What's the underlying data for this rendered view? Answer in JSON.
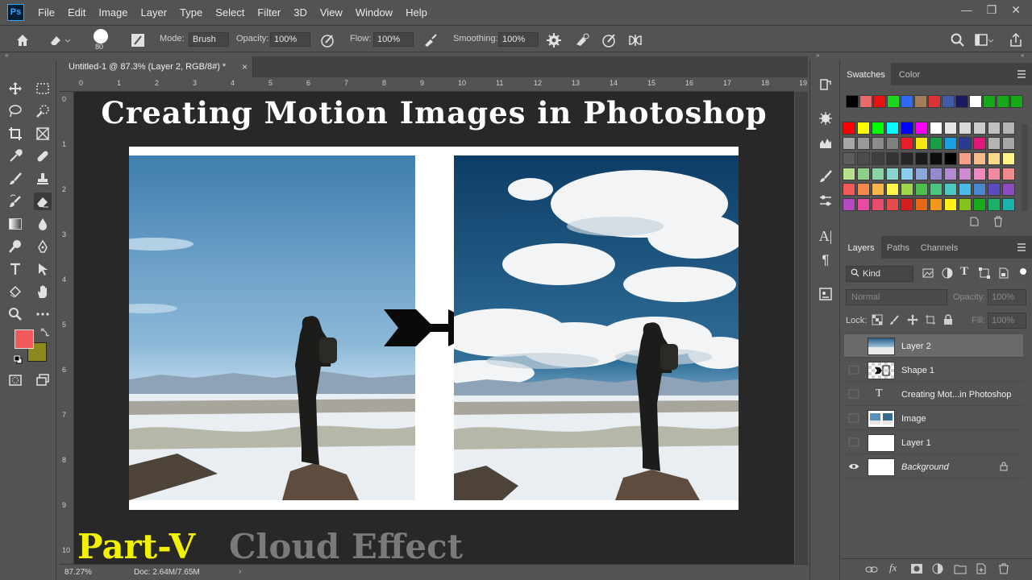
{
  "app": {
    "logo": "Ps"
  },
  "menu": [
    "File",
    "Edit",
    "Image",
    "Layer",
    "Type",
    "Select",
    "Filter",
    "3D",
    "View",
    "Window",
    "Help"
  ],
  "options_bar": {
    "brush_size": "80",
    "mode_label": "Mode:",
    "mode_value": "Brush",
    "opacity_label": "Opacity:",
    "opacity_value": "100%",
    "flow_label": "Flow:",
    "flow_value": "100%",
    "smoothing_label": "Smoothing:",
    "smoothing_value": "100%"
  },
  "document": {
    "tab_title": "Untitled-1 @ 87.3% (Layer 2, RGB/8#) *",
    "ruler_top": [
      "0",
      "1",
      "2",
      "3",
      "4",
      "5",
      "6",
      "7",
      "8",
      "9",
      "10",
      "11",
      "12",
      "13",
      "14",
      "15",
      "16",
      "17",
      "18",
      "19"
    ],
    "ruler_left": [
      "0",
      "1",
      "2",
      "3",
      "4",
      "5",
      "6",
      "7",
      "8",
      "9",
      "10"
    ],
    "headline": "Creating Motion Images  in Photoshop",
    "part_label": "Part-V",
    "effect_label": "Cloud Effect"
  },
  "status": {
    "zoom": "87.27%",
    "doc": "Doc: 2.64M/7.65M"
  },
  "colors": {
    "foreground": "#f15a5a",
    "background": "#8c8a1f",
    "part_color": "#f2f200",
    "effect_color": "#7a7a7a"
  },
  "swatches_panel": {
    "tabs": [
      "Swatches",
      "Color"
    ],
    "recent": [
      "#000000",
      "#e96a6a",
      "#e81212",
      "#1bd61b",
      "#2f6af5",
      "#a37d5a",
      "#d93333",
      "#3f5aa6",
      "#1a1a5e",
      "#ffffff",
      "#17a817",
      "#17a817",
      "#17a817"
    ],
    "grid": [
      [
        "#ff0000",
        "#ffff00",
        "#00ff00",
        "#00ffff",
        "#0000ff",
        "#ff00ff",
        "#ffffff",
        "#e6e6e6",
        "#d9d9d9",
        "#cccccc",
        "#bfbfbf",
        "#b3b3b3"
      ],
      [
        "#a6a6a6",
        "#999999",
        "#8c8c8c",
        "#808080",
        "#e81d25",
        "#f7e80f",
        "#1a9e44",
        "#1aa0e0",
        "#2b3a92",
        "#e0187a",
        "#b3b3b3",
        "#a6a6a6"
      ],
      [
        "#5c5c5c",
        "#4d4d4d",
        "#404040",
        "#333333",
        "#262626",
        "#1a1a1a",
        "#0d0d0d",
        "#000000",
        "#f4a08a",
        "#f6bc8a",
        "#fbd98a",
        "#fff38a"
      ],
      [
        "#b9e08a",
        "#8cd08a",
        "#8ad4a4",
        "#8ad6cf",
        "#8acdee",
        "#8aa8dc",
        "#958ad0",
        "#b18ad0",
        "#cf8ad0",
        "#f08abd",
        "#f08a9c",
        "#f08a8a"
      ],
      [
        "#f05a5a",
        "#f4874b",
        "#f9b44b",
        "#fff44b",
        "#9fd64b",
        "#4bc04b",
        "#4bc481",
        "#4bc8c2",
        "#4bb9ea",
        "#4b87d0",
        "#5c4bc0",
        "#8c4bc0"
      ],
      [
        "#b44bc0",
        "#e84ba0",
        "#e84b6d",
        "#e84b4b",
        "#d62020",
        "#e8681a",
        "#f2981a",
        "#fff21a",
        "#86c31a",
        "#1aab1a",
        "#1ab06a",
        "#1ab3ad"
      ]
    ]
  },
  "layers_panel": {
    "tabs": [
      "Layers",
      "Paths",
      "Channels"
    ],
    "filter_kind": "Kind",
    "blend_mode": "Normal",
    "opacity_label": "Opacity:",
    "opacity_value": "100%",
    "lock_label": "Lock:",
    "fill_label": "Fill:",
    "fill_value": "100%",
    "layers": [
      {
        "name": "Layer 2",
        "type": "image",
        "selected": true,
        "visible": false
      },
      {
        "name": "Shape 1",
        "type": "shape",
        "selected": false,
        "visible": false
      },
      {
        "name": "Creating Mot...in Photoshop",
        "type": "text",
        "selected": false,
        "visible": false
      },
      {
        "name": "Image",
        "type": "image",
        "selected": false,
        "visible": false
      },
      {
        "name": "Layer 1",
        "type": "white",
        "selected": false,
        "visible": false
      },
      {
        "name": "Background",
        "type": "white",
        "selected": false,
        "visible": true,
        "locked": true
      }
    ],
    "text_layer_glyph": "T"
  }
}
